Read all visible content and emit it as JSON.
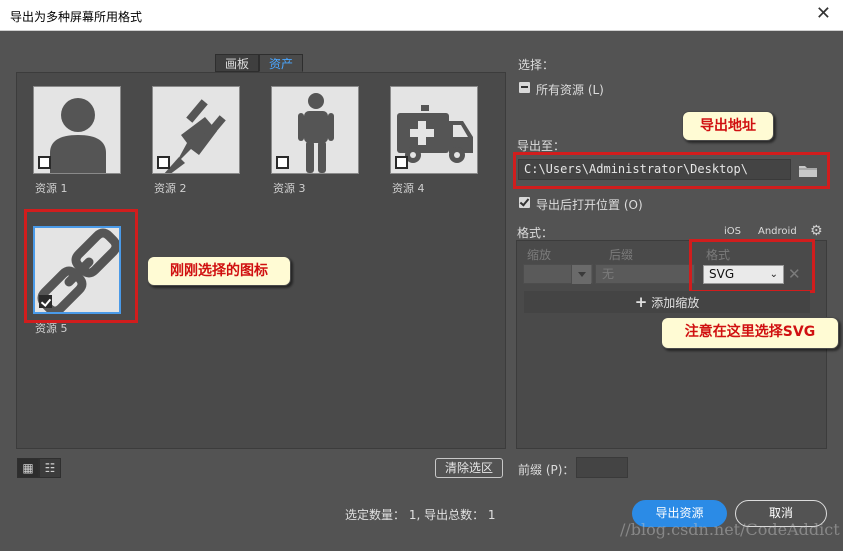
{
  "window": {
    "title": "导出为多种屏幕所用格式"
  },
  "tabs": [
    {
      "label": "画板"
    },
    {
      "label": "资产"
    }
  ],
  "assets": [
    {
      "label": "资源 1",
      "icon": "person-icon",
      "checked": false
    },
    {
      "label": "资源 2",
      "icon": "plug-icon",
      "checked": false
    },
    {
      "label": "资源 3",
      "icon": "standing-man-icon",
      "checked": false
    },
    {
      "label": "资源 4",
      "icon": "ambulance-icon",
      "checked": false
    },
    {
      "label": "资源 5",
      "icon": "chain-link-icon",
      "checked": true
    }
  ],
  "callouts": {
    "selected_icon": "刚刚选择的图标",
    "export_path": "导出地址",
    "choose_svg": "注意在这里选择SVG"
  },
  "left_footer": {
    "clear_selection": "清除选区"
  },
  "right": {
    "select_label": "选择：",
    "all_assets": "所有资源 (L)",
    "export_to_label": "导出至：",
    "export_path": "C:\\Users\\Administrator\\Desktop\\",
    "open_after_export": "导出后打开位置 (O)",
    "format_label": "格式：",
    "ios": "iOS",
    "android": "Android",
    "col_scale": "缩放",
    "col_suffix": "后缀",
    "col_format": "格式",
    "suffix_placeholder": "无",
    "format_value": "SVG",
    "add_scale": "添加缩放",
    "prefix_label": "前缀 (P)："
  },
  "footer": {
    "status": "选定数量： 1, 导出总数： 1",
    "export_button": "导出资源",
    "cancel_button": "取消",
    "watermark": "//blog.csdn.net/CodeAddict"
  },
  "colors": {
    "accent": "#2b8be6",
    "callout_text": "#d01010",
    "callout_bg": "#fffbd4",
    "highlight": "#d11d1d"
  }
}
